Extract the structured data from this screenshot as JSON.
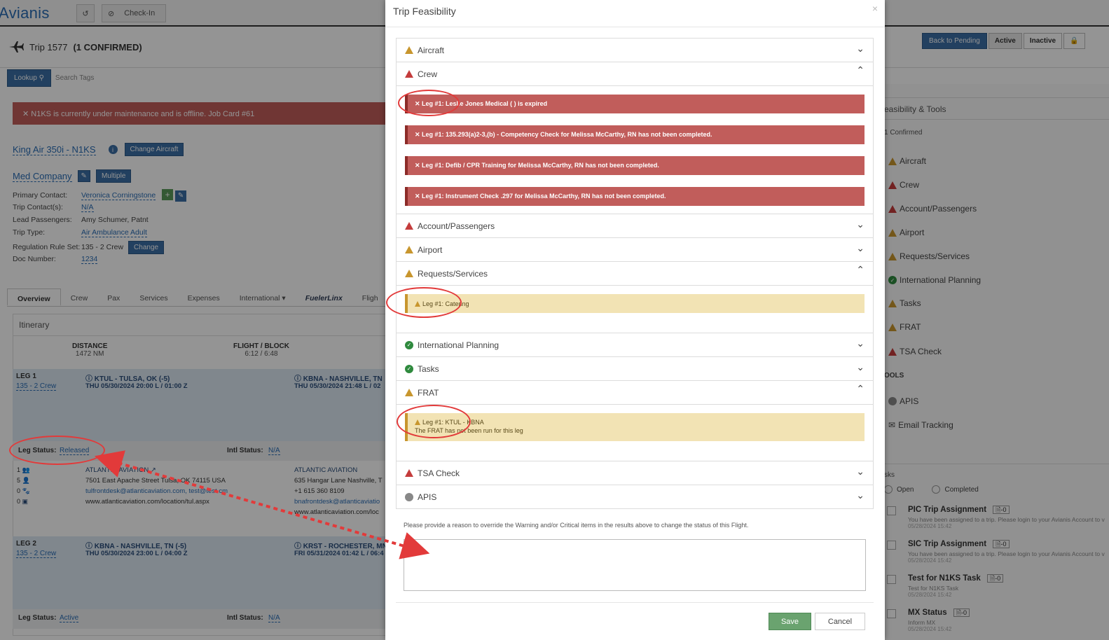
{
  "app": {
    "logo": "Avianis",
    "checkin_label": "Check-In"
  },
  "trip": {
    "label": "Trip 1577",
    "status": "(1 CONFIRMED)"
  },
  "header_buttons": {
    "back": "Back to Pending",
    "active": "Active",
    "inactive": "Inactive"
  },
  "search": {
    "lookup": "Lookup",
    "placeholder": "Search Tags"
  },
  "alert_text": "✕ N1KS is currently under maintenance and is offline. Job Card #61",
  "aircraft": {
    "name": "King Air 350i - N1KS",
    "change": "Change Aircraft"
  },
  "company": {
    "name": "Med Company",
    "multiple": "Multiple"
  },
  "details": [
    {
      "k": "Primary Contact:",
      "v": "Veronica Corningstone"
    },
    {
      "k": "Trip Contact(s):",
      "v": "N/A"
    },
    {
      "k": "Lead Passengers:",
      "v": "Amy Schumer, Patnt"
    },
    {
      "k": "Trip Type:",
      "v": "Air Ambulance Adult"
    },
    {
      "k": "Regulation Rule Set:",
      "v": "135 - 2 Crew"
    },
    {
      "k": "Doc Number:",
      "v": "1234"
    }
  ],
  "regulation_change": "Change",
  "tabs": [
    "Overview",
    "Crew",
    "Pax",
    "Services",
    "Expenses",
    "International ▾",
    "FuelerLinx",
    "Fligh"
  ],
  "itinerary": {
    "title": "Itinerary",
    "distance_label": "DISTANCE",
    "distance": "1472 NM",
    "flight_label": "FLIGHT / BLOCK",
    "flight": "6:12 / 6:48",
    "legs": [
      {
        "leg": "LEG 1",
        "crew": "135 - 2 Crew",
        "from": "KTUL - TULSA, OK (-5)",
        "from_time": "THU 05/30/2024 20:00 L / 01:00 Z",
        "to": "KBNA - NASHVILLE, TN",
        "to_time": "THU 05/30/2024 21:48 L / 02",
        "status_label": "Leg Status:",
        "status": "Released",
        "intl_label": "Intl Status:",
        "intl": "N/A"
      },
      {
        "leg": "LEG 2",
        "crew": "135 - 2 Crew",
        "from": "KBNA - NASHVILLE, TN (-5)",
        "from_time": "THU 05/30/2024 23:00 L / 04:00 Z",
        "to": "KRST - ROCHESTER, MN",
        "to_time": "FRI 05/31/2024 01:42 L / 06:4",
        "status_label": "Leg Status:",
        "status": "Active",
        "intl_label": "Intl Status:",
        "intl": "N/A"
      }
    ],
    "fbo_from": {
      "counts": [
        "1",
        "5",
        "0",
        "0"
      ],
      "name": "ATLANTIC AVIATION",
      "addr": "7501 East Apache Street Tulsa, OK 74115 USA",
      "email": "tulfrontdesk@atlanticaviation.com, test@test.cm",
      "web": "www.atlanticaviation.com/location/tul.aspx"
    },
    "fbo_to": {
      "name": "ATLANTIC AVIATION",
      "addr": "635 Hangar Lane Nashville, T",
      "phone": "+1 615 360 8109",
      "email": "bnafrontdesk@atlanticaviatio",
      "web": "www.atlanticaviation.com/loc"
    }
  },
  "right": {
    "feasibility": "easibility & Tools",
    "confirmed": "1 Confirmed",
    "items": [
      "Aircraft",
      "Crew",
      "Account/Passengers",
      "Airport",
      "Requests/Services",
      "International Planning",
      "Tasks",
      "FRAT",
      "TSA Check"
    ],
    "tools_label": "OOLS",
    "tools": [
      "APIS",
      "Email Tracking"
    ],
    "tasks_label": "sks",
    "open": "Open",
    "completed": "Completed",
    "tasks": [
      {
        "title": "PIC Trip Assignment",
        "count": "0",
        "sub": "You have been assigned to a trip. Please login to your Avianis Account to v",
        "date": "05/28/2024 15:42"
      },
      {
        "title": "SIC Trip Assignment",
        "count": "0",
        "sub": "You have been assigned to a trip. Please login to your Avianis Account to v",
        "date": "05/28/2024 15:42"
      },
      {
        "title": "Test for N1KS Task",
        "count": "0",
        "sub": "Test for N1KS Task",
        "date": "05/28/2024 15:42"
      },
      {
        "title": "MX Status",
        "count": "0",
        "sub": "Inform MX",
        "date": "05/28/2024 15:42"
      }
    ]
  },
  "modal": {
    "title": "Trip Feasibility",
    "close": "×",
    "sections": {
      "aircraft": "Aircraft",
      "crew": "Crew",
      "account": "Account/Passengers",
      "airport": "Airport",
      "requests": "Requests/Services",
      "intl": "International Planning",
      "tasks": "Tasks",
      "frat": "FRAT",
      "tsa": "TSA Check",
      "apis": "APIS"
    },
    "crew_alerts": [
      "✕ Leg #1: Leslie Jones Medical ( ) is expired",
      "✕ Leg #1: 135.293(a)2-3,(b) - Competency Check for Melissa McCarthy, RN has not been completed.",
      "✕ Leg #1: Defib / CPR Training for Melissa McCarthy, RN has not been completed.",
      "✕ Leg #1: Instrument Check .297 for Melissa McCarthy, RN has not been completed."
    ],
    "requests_alert": "Leg #1: Catering",
    "frat_alert_title": "Leg #1: KTUL - KBNA",
    "frat_alert_sub": "The FRAT has not been run for this leg",
    "reason_text": "Please provide a reason to override the Warning and/or Critical items in the results above to change the status of this Flight.",
    "save": "Save",
    "cancel": "Cancel"
  },
  "colors": {
    "critical": "#c15d5b",
    "warning": "#f2e3b4",
    "ok": "#2f8a3e",
    "primary": "#3b6fa5",
    "save": "#6aa36f",
    "annotation": "#e23a3a"
  }
}
